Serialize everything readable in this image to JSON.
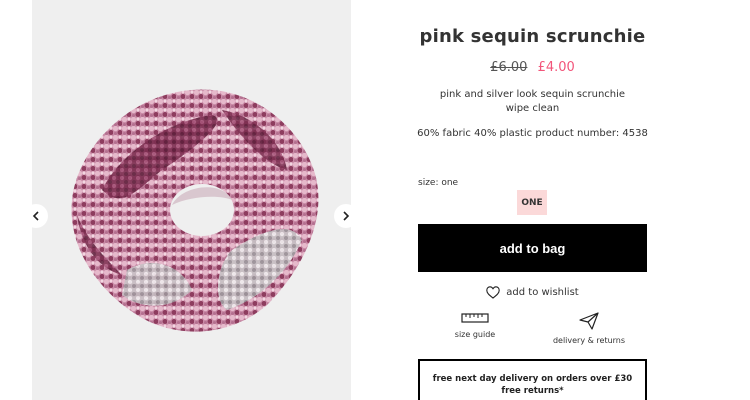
{
  "product": {
    "title": "pink sequin scrunchie",
    "price_old": "£6.00",
    "price_new": "£4.00",
    "description_line1": "pink and silver look sequin scrunchie",
    "description_line2": "wipe clean",
    "composition": "60% fabric 40% plastic product number: 4538",
    "image_alt": "pink sequin scrunchie"
  },
  "size": {
    "label": "size: one",
    "options": [
      "ONE"
    ],
    "selected": "ONE"
  },
  "actions": {
    "add_to_bag": "add to bag",
    "wishlist": "add to wishlist"
  },
  "utilities": {
    "size_guide": "size guide",
    "delivery_returns": "delivery & returns"
  },
  "delivery": {
    "line1": "free next day delivery on orders over £30",
    "line2": "free returns*"
  },
  "colors": {
    "sale_price": "#f2557a",
    "size_selected_bg": "#fbd9d9",
    "button_bg": "#000000",
    "gallery_bg": "#efefef"
  },
  "icons": {
    "prev": "chevron-left-icon",
    "next": "chevron-right-icon",
    "wishlist": "heart-icon",
    "size_guide": "ruler-icon",
    "delivery": "paper-plane-icon"
  }
}
